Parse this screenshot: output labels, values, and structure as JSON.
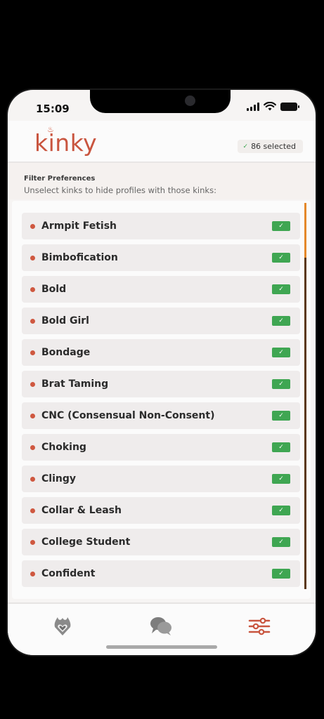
{
  "status_bar": {
    "time": "15:09"
  },
  "header": {
    "logo": "kinky",
    "selected_badge": "86 selected"
  },
  "filter": {
    "title": "Filter Preferences",
    "subtitle": "Unselect kinks to hide profiles with those kinks:"
  },
  "kinks": [
    {
      "label": "Armpit Fetish",
      "checked": true
    },
    {
      "label": "Bimbofication",
      "checked": true
    },
    {
      "label": "Bold",
      "checked": true
    },
    {
      "label": "Bold Girl",
      "checked": true
    },
    {
      "label": "Bondage",
      "checked": true
    },
    {
      "label": "Brat Taming",
      "checked": true
    },
    {
      "label": "CNC (Consensual Non-Consent)",
      "checked": true
    },
    {
      "label": "Choking",
      "checked": true
    },
    {
      "label": "Clingy",
      "checked": true
    },
    {
      "label": "Collar & Leash",
      "checked": true
    },
    {
      "label": "College Student",
      "checked": true
    },
    {
      "label": "Confident",
      "checked": true
    }
  ],
  "nav": {
    "items": [
      {
        "icon": "flame-heart-icon"
      },
      {
        "icon": "chat-bubbles-icon"
      },
      {
        "icon": "sliders-icon",
        "active": true
      }
    ]
  },
  "colors": {
    "accent": "#c9553f",
    "check": "#3fa652",
    "scroll_thumb": "#e5892b"
  }
}
